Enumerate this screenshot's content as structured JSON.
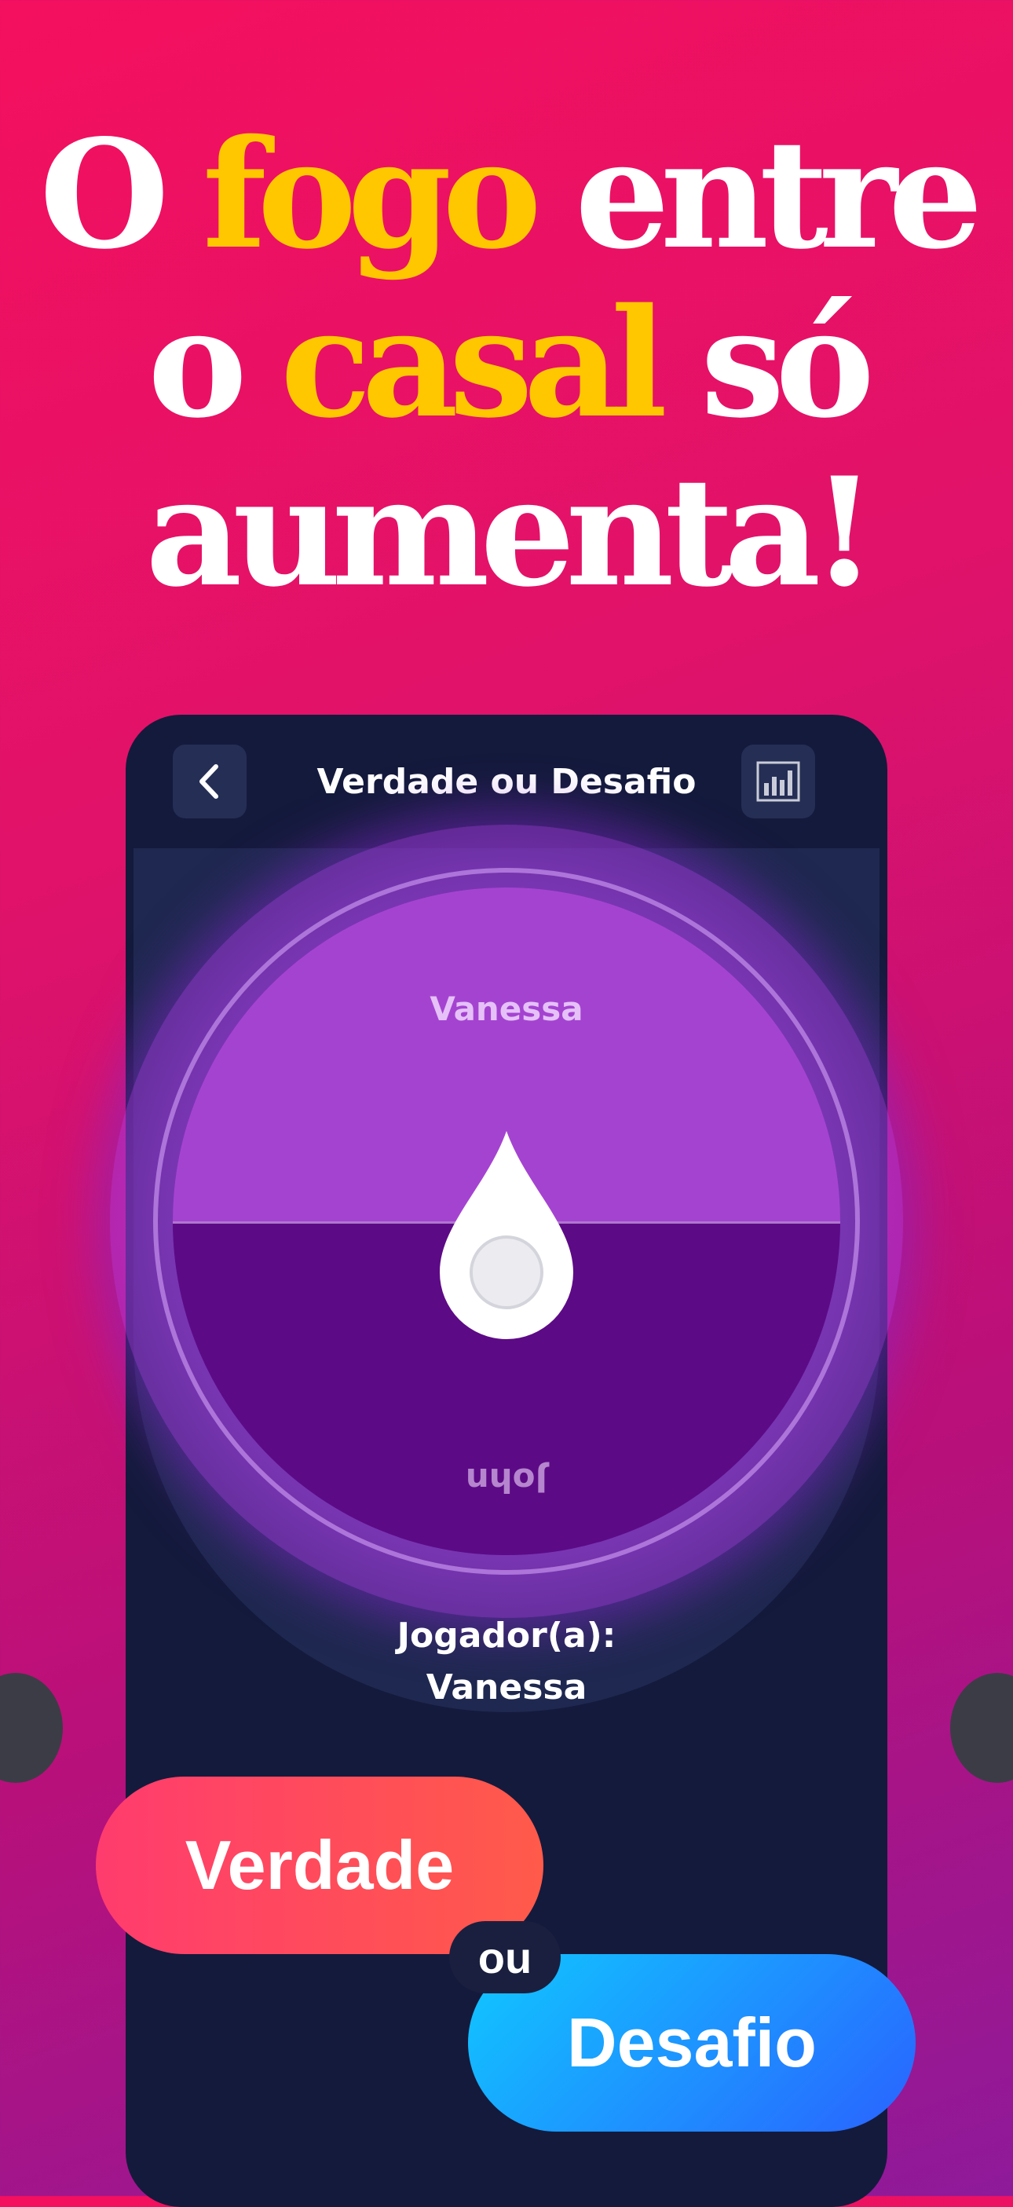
{
  "headline": {
    "line1_a": "O",
    "line1_b": "fogo",
    "line1_c": "entre",
    "line2_a": "o",
    "line2_b": "casal",
    "line2_c": "só",
    "line3": "aumenta!"
  },
  "header": {
    "title": "Verdade ou Desafio",
    "back_icon": "chevron-left-icon",
    "stats_icon": "bar-chart-icon"
  },
  "wheel": {
    "top_name": "Vanessa",
    "bottom_name": "John"
  },
  "player": {
    "label": "Jogador(a):",
    "name": "Vanessa"
  },
  "choices": {
    "truth": "Verdade",
    "or": "ou",
    "dare": "Desafio"
  },
  "colors": {
    "accent_yellow": "#ffc700",
    "phone_bg": "#141a3c",
    "wheel_top": "#a543d1",
    "wheel_bottom": "#5d0a86",
    "truth_pill": "#ff4560",
    "dare_pill": "#1e90ff"
  }
}
